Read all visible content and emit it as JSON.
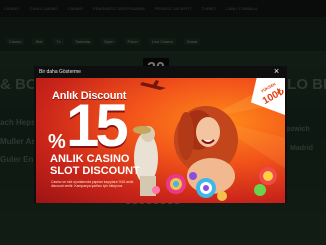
{
  "background": {
    "top_nav": [
      "CASINO",
      "CANLI CASINO",
      "CASINO",
      "PRAGMATIC DROPS&WINS",
      "PEGASIT JACKPOT",
      "TURBO",
      "CANLI TOMBALA"
    ],
    "categories": [
      "Casino",
      "Slot",
      "Tv",
      "Tombala",
      "Oyun",
      "Poker",
      "Live Casino",
      "Sanal"
    ],
    "hero_left": "& BO",
    "hero_right": "LLO BE",
    "item1": "ach Hepsi Ka",
    "item2": "Muller Asis",
    "item3": "Guler En Az",
    "item4": "pswich",
    "item5": "Madrid",
    "number_box": "30"
  },
  "modal": {
    "header_title": "Bir daha Gösterme",
    "close_symbol": "×",
    "promo": {
      "line1": "Anlık Discount",
      "percent_sign": "%",
      "percent_value": "15",
      "line2": "ANLIK CASINO",
      "line3": "SLOT DISCOUNT",
      "badge_top": "YÜKSEK",
      "badge_value": "100₺",
      "fine_print": "Casino ve slot oyunlarında yapılan kayıplara %15 anlık discount verilir. Kampanya şartları için tıklayınız."
    }
  },
  "colors": {
    "banner_orange": "#f2541a",
    "banner_red": "#c9241a",
    "modal_bg": "#0e0e0e"
  }
}
